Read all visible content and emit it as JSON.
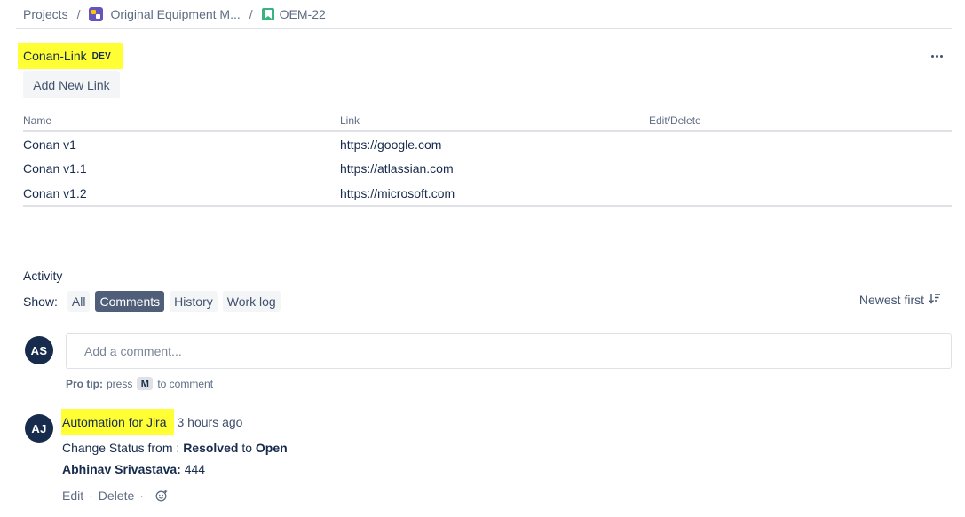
{
  "breadcrumb": {
    "projects": "Projects",
    "separator": "/",
    "project_name": "Original Equipment M...",
    "issue_key": "OEM-22"
  },
  "panel": {
    "title": "Conan-Link",
    "env_badge": "DEV",
    "add_button": "Add New Link",
    "columns": [
      "Name",
      "Link",
      "Edit/Delete"
    ],
    "rows": [
      {
        "name": "Conan v1",
        "link": "https://google.com"
      },
      {
        "name": "Conan v1.1",
        "link": "https://atlassian.com"
      },
      {
        "name": "Conan v1.2",
        "link": "https://microsoft.com"
      }
    ]
  },
  "activity": {
    "title": "Activity",
    "show_label": "Show:",
    "filters": [
      "All",
      "Comments",
      "History",
      "Work log"
    ],
    "active_filter": "Comments",
    "sort_label": "Newest first",
    "current_user_initials": "AS",
    "comment_placeholder": "Add a comment...",
    "pro_tip_label": "Pro tip:",
    "pro_tip_press": "press",
    "pro_tip_key": "M",
    "pro_tip_suffix": "to comment"
  },
  "comment": {
    "initials": "AJ",
    "author": "Automation for Jira",
    "time": "3 hours ago",
    "change_prefix": "Change Status from :",
    "from_status": "Resolved",
    "to_word": "to",
    "to_status": "Open",
    "field_name": "Abhinav Srivastava:",
    "field_value": "444",
    "edit": "Edit",
    "delete": "Delete",
    "action_separator": "·"
  },
  "colors": {
    "highlight": "#ffff33",
    "active_filter_bg": "#505f79",
    "avatar_bg": "#172b4d",
    "project_icon": "#6554c0",
    "story_icon": "#36b37e"
  },
  "icons": {
    "project": "project-avatar-icon",
    "issue_type": "story-icon",
    "more": "more-actions-icon",
    "sort": "sort-descending-icon",
    "reaction": "add-reaction-icon"
  }
}
